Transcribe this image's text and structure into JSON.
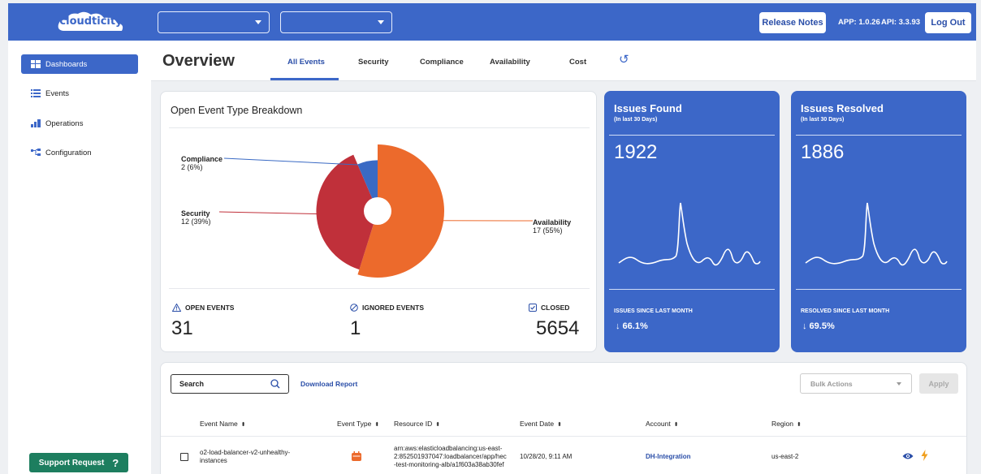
{
  "topbar": {
    "logo_text": "cloudticity",
    "release_notes": "Release Notes",
    "app_version": "APP: 1.0.26",
    "api_version": "API: 3.3.93",
    "logout": "Log Out"
  },
  "sidebar": {
    "items": [
      {
        "label": "Dashboards",
        "icon": "dashboard-icon",
        "active": true
      },
      {
        "label": "Events",
        "icon": "list-icon"
      },
      {
        "label": "Operations",
        "icon": "bar-chart-icon"
      },
      {
        "label": "Configuration",
        "icon": "hierarchy-icon"
      }
    ],
    "support": "Support Request",
    "support_glyph": "?"
  },
  "header": {
    "title": "Overview",
    "tabs": [
      "All Events",
      "Security",
      "Compliance",
      "Availability",
      "Cost"
    ],
    "active_tab": "All Events",
    "refresh_glyph": "↺"
  },
  "breakdown": {
    "title": "Open Event Type Breakdown",
    "slices": [
      {
        "name": "Compliance",
        "value": 2,
        "pct": "6%",
        "label": "2 (6%)",
        "color": "#3a6ac4"
      },
      {
        "name": "Security",
        "value": 12,
        "pct": "39%",
        "label": "12 (39%)",
        "color": "#c0303a"
      },
      {
        "name": "Availability",
        "value": 17,
        "pct": "55%",
        "label": "17 (55%)",
        "color": "#ec6a2c"
      }
    ],
    "open_events_label": "OPEN EVENTS",
    "open_events": "31",
    "ignored_events_label": "IGNORED EVENTS",
    "ignored_events": "1",
    "closed_label": "CLOSED",
    "closed": "5654"
  },
  "issues_found": {
    "title": "Issues Found",
    "subtitle": "(In last 30 Days)",
    "value": "1922",
    "footer": "ISSUES SINCE LAST MONTH",
    "change": "↓  66.1%"
  },
  "issues_resolved": {
    "title": "Issues Resolved",
    "subtitle": "(In last 30 Days)",
    "value": "1886",
    "footer": "RESOLVED SINCE LAST MONTH",
    "change": "↓  69.5%"
  },
  "table": {
    "search_placeholder": "Search",
    "download": "Download Report",
    "bulk_actions": "Bulk Actions",
    "apply": "Apply",
    "columns": [
      "Event Name",
      "Event Type",
      "Resource ID",
      "Event Date",
      "Account",
      "Region"
    ],
    "sort_glyph": "⬍",
    "rows": [
      {
        "event_name_1": "o2-load-balancer-v2-unhealthy-",
        "event_name_2": "instances",
        "resource_1": "arn:aws:elasticloadbalancing:us-east-",
        "resource_2": "2:852501937047:loadbalancer/app/hec",
        "resource_3": "-test-monitoring-alb/a1f603a38ab30fef",
        "date": "10/28/20, 9:11 AM",
        "account": "DH-Integration",
        "region": "us-east-2"
      }
    ]
  },
  "colors": {
    "brand": "#3c67c8",
    "support": "#1d7e5f",
    "event_type_icon": "#ec6a2c",
    "action_bolt": "#f0a020"
  }
}
